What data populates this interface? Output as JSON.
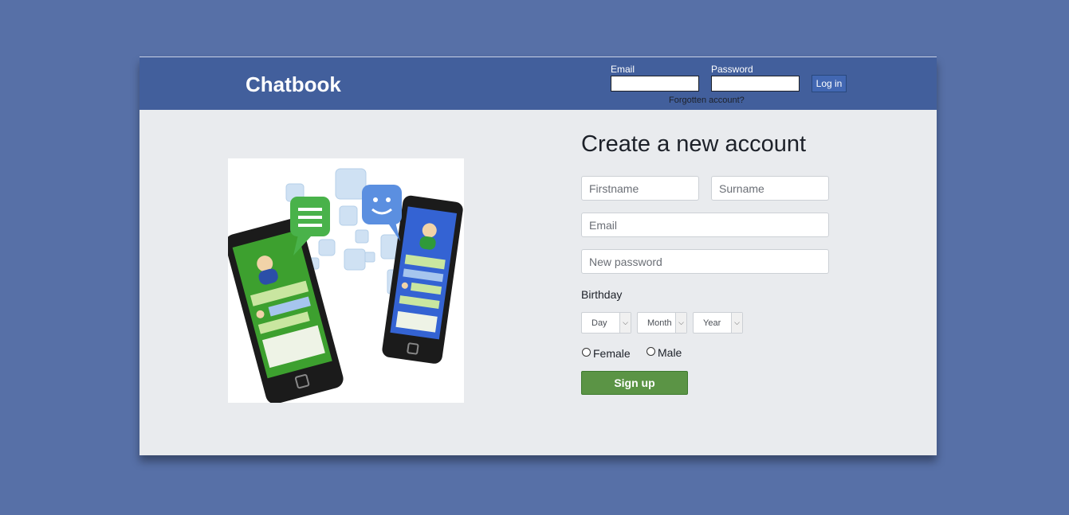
{
  "header": {
    "logo": "Chatbook",
    "email_label": "Email",
    "password_label": "Password",
    "login_label": "Log in",
    "forgot_label": "Forgotten account?"
  },
  "signup": {
    "title": "Create a new account",
    "firstname_placeholder": "Firstname",
    "surname_placeholder": "Surname",
    "email_placeholder": "Email",
    "password_placeholder": "New password",
    "birthday_label": "Birthday",
    "day_label": "Day",
    "month_label": "Month",
    "year_label": "Year",
    "female_label": "Female",
    "male_label": "Male",
    "button_label": "Sign up"
  },
  "colors": {
    "page_bg": "#5770a7",
    "header_bg": "#425f9c",
    "signup_green": "#5b9445",
    "login_blue": "#4267b2"
  },
  "icons": [
    "phones-chat-illustration",
    "chevron-down-icon",
    "radio-icon"
  ]
}
